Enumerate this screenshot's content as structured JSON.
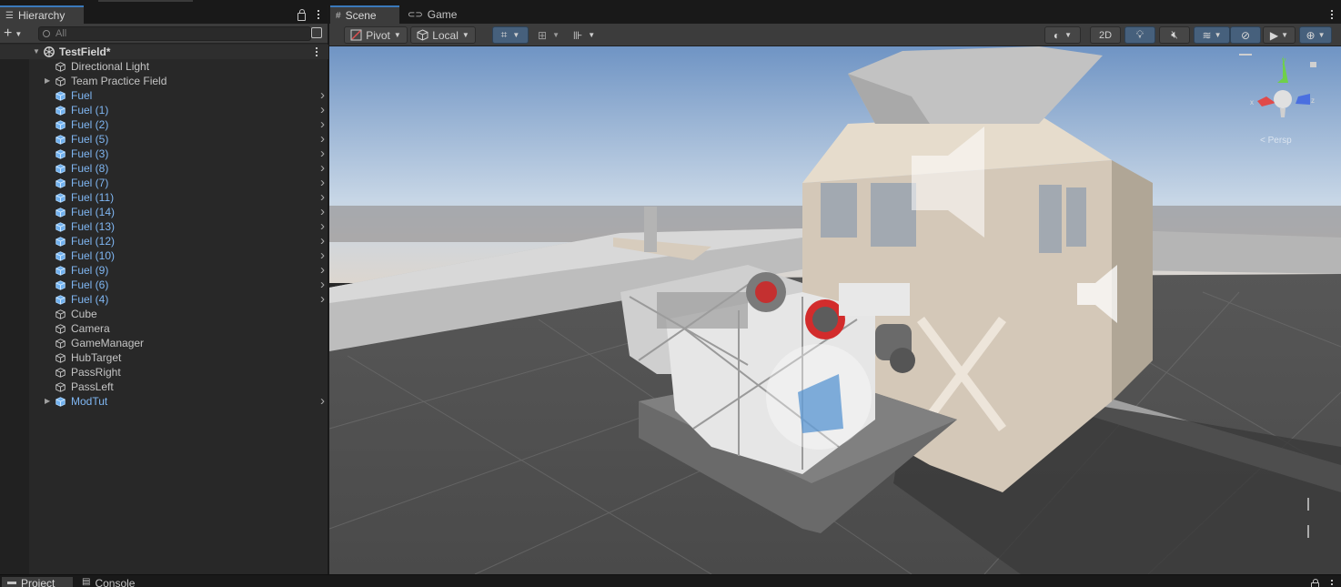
{
  "hierarchy": {
    "tab_label": "Hierarchy",
    "search_placeholder": "All",
    "scene_name": "TestField*",
    "items": [
      {
        "label": "Directional Light",
        "style": "gray",
        "foldout": false,
        "chevron": false,
        "icon": "gameobject-icon"
      },
      {
        "label": "Team Practice Field",
        "style": "gray",
        "foldout": true,
        "chevron": false,
        "icon": "gameobject-icon"
      },
      {
        "label": "Fuel",
        "style": "blue",
        "foldout": false,
        "chevron": true,
        "icon": "prefab-icon"
      },
      {
        "label": "Fuel (1)",
        "style": "blue",
        "foldout": false,
        "chevron": true,
        "icon": "prefab-icon"
      },
      {
        "label": "Fuel (2)",
        "style": "blue",
        "foldout": false,
        "chevron": true,
        "icon": "prefab-icon"
      },
      {
        "label": "Fuel (5)",
        "style": "blue",
        "foldout": false,
        "chevron": true,
        "icon": "prefab-icon"
      },
      {
        "label": "Fuel (3)",
        "style": "blue",
        "foldout": false,
        "chevron": true,
        "icon": "prefab-icon"
      },
      {
        "label": "Fuel (8)",
        "style": "blue",
        "foldout": false,
        "chevron": true,
        "icon": "prefab-icon"
      },
      {
        "label": "Fuel (7)",
        "style": "blue",
        "foldout": false,
        "chevron": true,
        "icon": "prefab-icon"
      },
      {
        "label": "Fuel (11)",
        "style": "blue",
        "foldout": false,
        "chevron": true,
        "icon": "prefab-icon"
      },
      {
        "label": "Fuel (14)",
        "style": "blue",
        "foldout": false,
        "chevron": true,
        "icon": "prefab-icon"
      },
      {
        "label": "Fuel (13)",
        "style": "blue",
        "foldout": false,
        "chevron": true,
        "icon": "prefab-icon"
      },
      {
        "label": "Fuel (12)",
        "style": "blue",
        "foldout": false,
        "chevron": true,
        "icon": "prefab-icon"
      },
      {
        "label": "Fuel (10)",
        "style": "blue",
        "foldout": false,
        "chevron": true,
        "icon": "prefab-icon"
      },
      {
        "label": "Fuel (9)",
        "style": "blue",
        "foldout": false,
        "chevron": true,
        "icon": "prefab-icon"
      },
      {
        "label": "Fuel (6)",
        "style": "blue",
        "foldout": false,
        "chevron": true,
        "icon": "prefab-icon"
      },
      {
        "label": "Fuel (4)",
        "style": "blue",
        "foldout": false,
        "chevron": true,
        "icon": "prefab-icon"
      },
      {
        "label": "Cube",
        "style": "gray",
        "foldout": false,
        "chevron": false,
        "icon": "gameobject-icon"
      },
      {
        "label": "Camera",
        "style": "gray",
        "foldout": false,
        "chevron": false,
        "icon": "gameobject-icon"
      },
      {
        "label": "GameManager",
        "style": "gray",
        "foldout": false,
        "chevron": false,
        "icon": "gameobject-icon"
      },
      {
        "label": "HubTarget",
        "style": "gray",
        "foldout": false,
        "chevron": false,
        "icon": "gameobject-icon"
      },
      {
        "label": "PassRight",
        "style": "gray",
        "foldout": false,
        "chevron": false,
        "icon": "gameobject-icon"
      },
      {
        "label": "PassLeft",
        "style": "gray",
        "foldout": false,
        "chevron": false,
        "icon": "gameobject-icon"
      },
      {
        "label": "ModTut",
        "style": "blue",
        "foldout": true,
        "chevron": true,
        "icon": "prefab-icon"
      }
    ]
  },
  "scene": {
    "tabs": [
      {
        "label": "Scene",
        "icon": "grid-icon",
        "active": true
      },
      {
        "label": "Game",
        "icon": "gamepad-icon",
        "active": false
      }
    ],
    "toolbar": {
      "pivot_label": "Pivot",
      "local_label": "Local",
      "two_d_label": "2D"
    },
    "gizmo": {
      "persp_label": "< Persp"
    }
  },
  "bottom": {
    "tabs": [
      {
        "label": "Project"
      },
      {
        "label": "Console"
      }
    ]
  },
  "colors": {
    "accent": "#3a79bb",
    "prefab_blue": "#7fb6f2",
    "panel": "#282828",
    "toolbar": "#3c3c3c"
  }
}
